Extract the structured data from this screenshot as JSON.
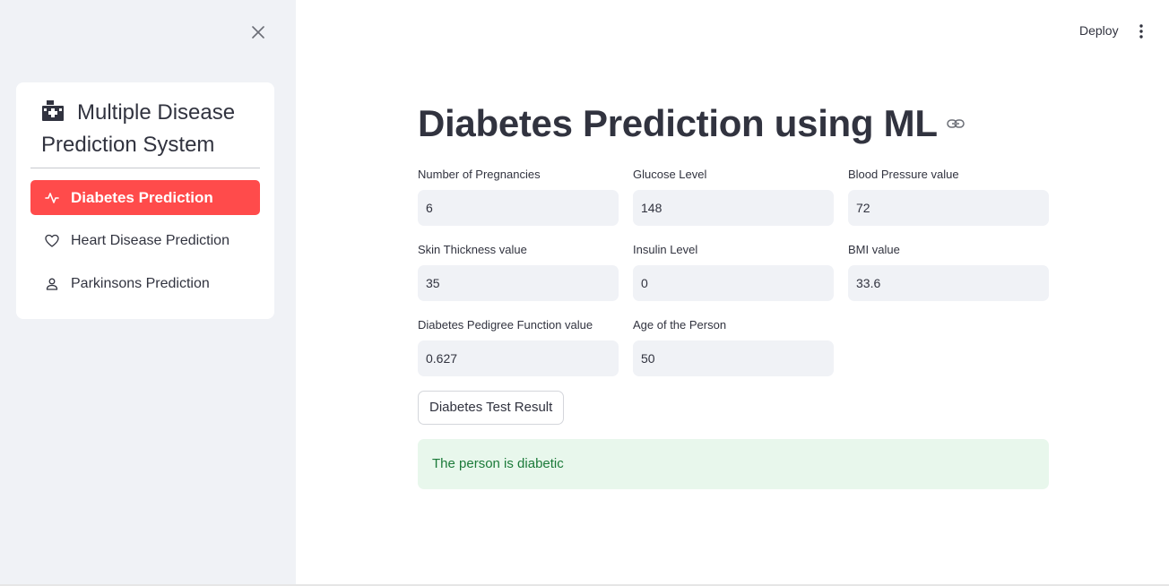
{
  "sidebar": {
    "title": "Multiple Disease Prediction System",
    "items": [
      {
        "label": "Diabetes Prediction",
        "icon": "activity-icon",
        "active": true
      },
      {
        "label": "Heart Disease Prediction",
        "icon": "heart-icon",
        "active": false
      },
      {
        "label": "Parkinsons Prediction",
        "icon": "person-icon",
        "active": false
      }
    ]
  },
  "topbar": {
    "deploy_label": "Deploy",
    "menu_icon": "kebab-menu-icon"
  },
  "main": {
    "title": "Diabetes Prediction using ML",
    "fields": [
      {
        "label": "Number of Pregnancies",
        "value": "6"
      },
      {
        "label": "Glucose Level",
        "value": "148"
      },
      {
        "label": "Blood Pressure value",
        "value": "72"
      },
      {
        "label": "Skin Thickness value",
        "value": "35"
      },
      {
        "label": "Insulin Level",
        "value": "0"
      },
      {
        "label": "BMI value",
        "value": "33.6"
      },
      {
        "label": "Diabetes Pedigree Function value",
        "value": "0.627"
      },
      {
        "label": "Age of the Person",
        "value": "50"
      }
    ],
    "submit_label": "Diabetes Test Result",
    "result_text": "The person is diabetic"
  },
  "colors": {
    "accent": "#ff4b4b",
    "sidebar_bg": "#f0f2f6",
    "success_bg": "#e8f7ec",
    "success_text": "#1b7a39"
  }
}
